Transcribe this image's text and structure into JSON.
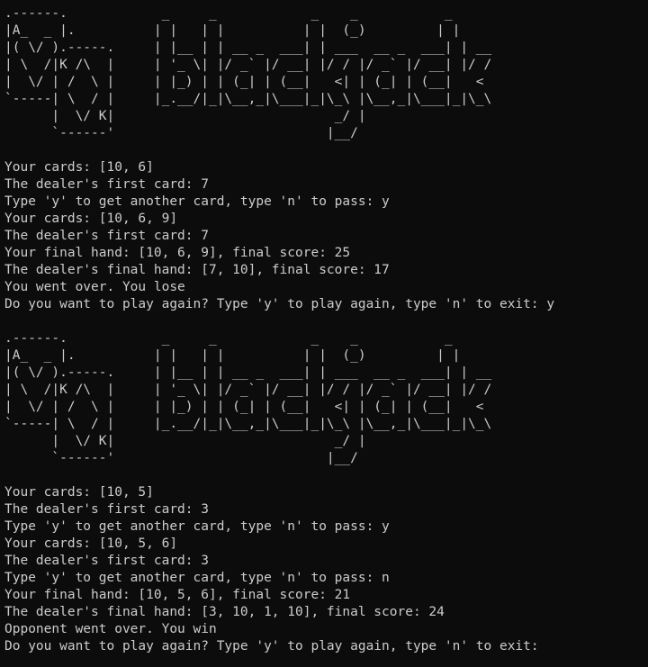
{
  "terminal": {
    "lines": [
      ".------.            _     _            _    _           _",
      "|A_  _ |.          | |   | |          | |  (_)         | |",
      "|( \\/ ).-----.     | |__ | | __ _  ___| | ___  __ _  ___| | __",
      "| \\  /|K /\\  |     | '_ \\| |/ _` |/ __| |/ / |/ _` |/ __| |/ /",
      "|  \\/ | /  \\ |     | |_) | | (_| | (__|   <| | (_| | (__|   <",
      "`-----| \\  / |     |_.__/|_|\\__,_|\\___|_|\\_\\ |\\__,_|\\___|_|\\_\\",
      "      |  \\/ K|                            _/ |",
      "      `------'                           |__/",
      "",
      "Your cards: [10, 6]",
      "The dealer's first card: 7",
      "Type 'y' to get another card, type 'n' to pass: y",
      "Your cards: [10, 6, 9]",
      "The dealer's first card: 7",
      "Your final hand: [10, 6, 9], final score: 25",
      "The dealer's final hand: [7, 10], final score: 17",
      "You went over. You lose",
      "Do you want to play again? Type 'y' to play again, type 'n' to exit: y",
      "",
      ".------.            _     _            _    _           _",
      "|A_  _ |.          | |   | |          | |  (_)         | |",
      "|( \\/ ).-----.     | |__ | | __ _  ___| | ___  __ _  ___| | __",
      "| \\  /|K /\\  |     | '_ \\| |/ _` |/ __| |/ / |/ _` |/ __| |/ /",
      "|  \\/ | /  \\ |     | |_) | | (_| | (__|   <| | (_| | (__|   <",
      "`-----| \\  / |     |_.__/|_|\\__,_|\\___|_|\\_\\ |\\__,_|\\___|_|\\_\\",
      "      |  \\/ K|                            _/ |",
      "      `------'                           |__/",
      "",
      "Your cards: [10, 5]",
      "The dealer's first card: 3",
      "Type 'y' to get another card, type 'n' to pass: y",
      "Your cards: [10, 5, 6]",
      "The dealer's first card: 3",
      "Type 'y' to get another card, type 'n' to pass: n",
      "Your final hand: [10, 5, 6], final score: 21",
      "The dealer's final hand: [3, 10, 1, 10], final score: 24",
      "Opponent went over. You win",
      "Do you want to play again? Type 'y' to play again, type 'n' to exit:"
    ]
  }
}
